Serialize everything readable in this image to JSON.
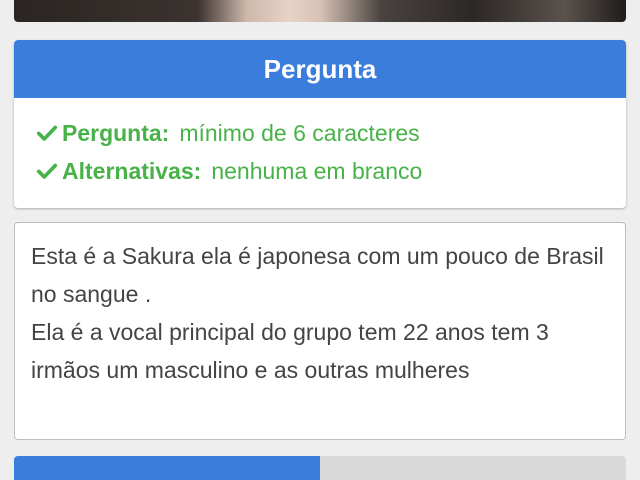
{
  "question_card": {
    "title": "Pergunta",
    "requirements": [
      {
        "key": "Pergunta:",
        "value": "mínimo de 6 caracteres"
      },
      {
        "key": "Alternativas:",
        "value": "nenhuma em branco"
      }
    ]
  },
  "text_box": {
    "content": "Esta é a Sakura ela é japonesa com um pouco de Brasil no sangue .\nEla é a vocal principal do grupo tem 22 anos tem 3 irmãos um masculino e as outras mulheres"
  },
  "progress": {
    "fraction": 0.5
  },
  "colors": {
    "accent": "#3b7ddd",
    "success": "#47b247"
  },
  "icons": {
    "requirement": "check-icon"
  }
}
